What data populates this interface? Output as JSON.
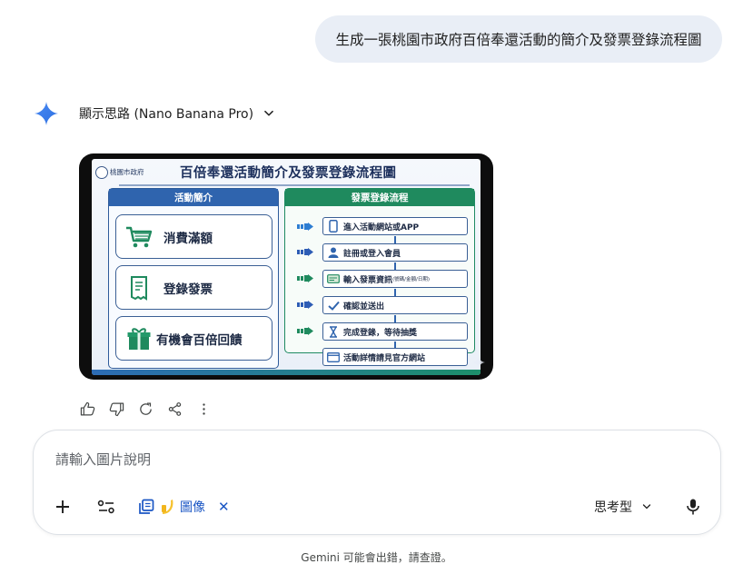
{
  "user_prompt": "生成一張桃園市政府百倍奉還活動的簡介及發票登錄流程圖",
  "response": {
    "thinking_label": "顯示思路 (Nano Banana Pro)",
    "thinking_icon": "chevron-down-icon",
    "image": {
      "agency_name": "桃園市政府",
      "title": "百倍奉還活動簡介及發票登錄流程圖",
      "intro_panel": {
        "header": "活動簡介",
        "items": [
          {
            "icon": "shopping-cart-icon",
            "label": "消費滿額"
          },
          {
            "icon": "receipt-icon",
            "label": "登錄發票"
          },
          {
            "icon": "gift-icon",
            "label": "有機會百倍回饋"
          }
        ]
      },
      "flow_panel": {
        "header": "發票登錄流程",
        "steps": [
          {
            "icon": "phone-icon",
            "label": "進入活動網站或APP",
            "note": ""
          },
          {
            "icon": "user-icon",
            "label": "註冊或登入會員",
            "note": ""
          },
          {
            "icon": "card-icon",
            "label": "輸入發票資訊",
            "note": "(號碼/金額/日期)"
          },
          {
            "icon": "check-icon",
            "label": "確認並送出",
            "note": ""
          },
          {
            "icon": "hourglass-icon",
            "label": "完成登錄，等待抽獎",
            "note": ""
          }
        ],
        "final": {
          "icon": "browser-icon",
          "label": "活動詳情請見官方網站"
        }
      }
    },
    "actions": [
      "thumb-up-icon",
      "thumb-down-icon",
      "regenerate-icon",
      "share-icon",
      "more-icon"
    ]
  },
  "composer": {
    "placeholder": "請輸入圖片說明",
    "chip_label": "圖像",
    "mode_label": "思考型"
  },
  "disclaimer": "Gemini 可能會出錯，請查證。",
  "colors": {
    "accent_blue": "#1a56c4",
    "bubble": "#e9eef6",
    "panel_blue": "#2f64ae",
    "panel_green": "#1f8a5e"
  }
}
